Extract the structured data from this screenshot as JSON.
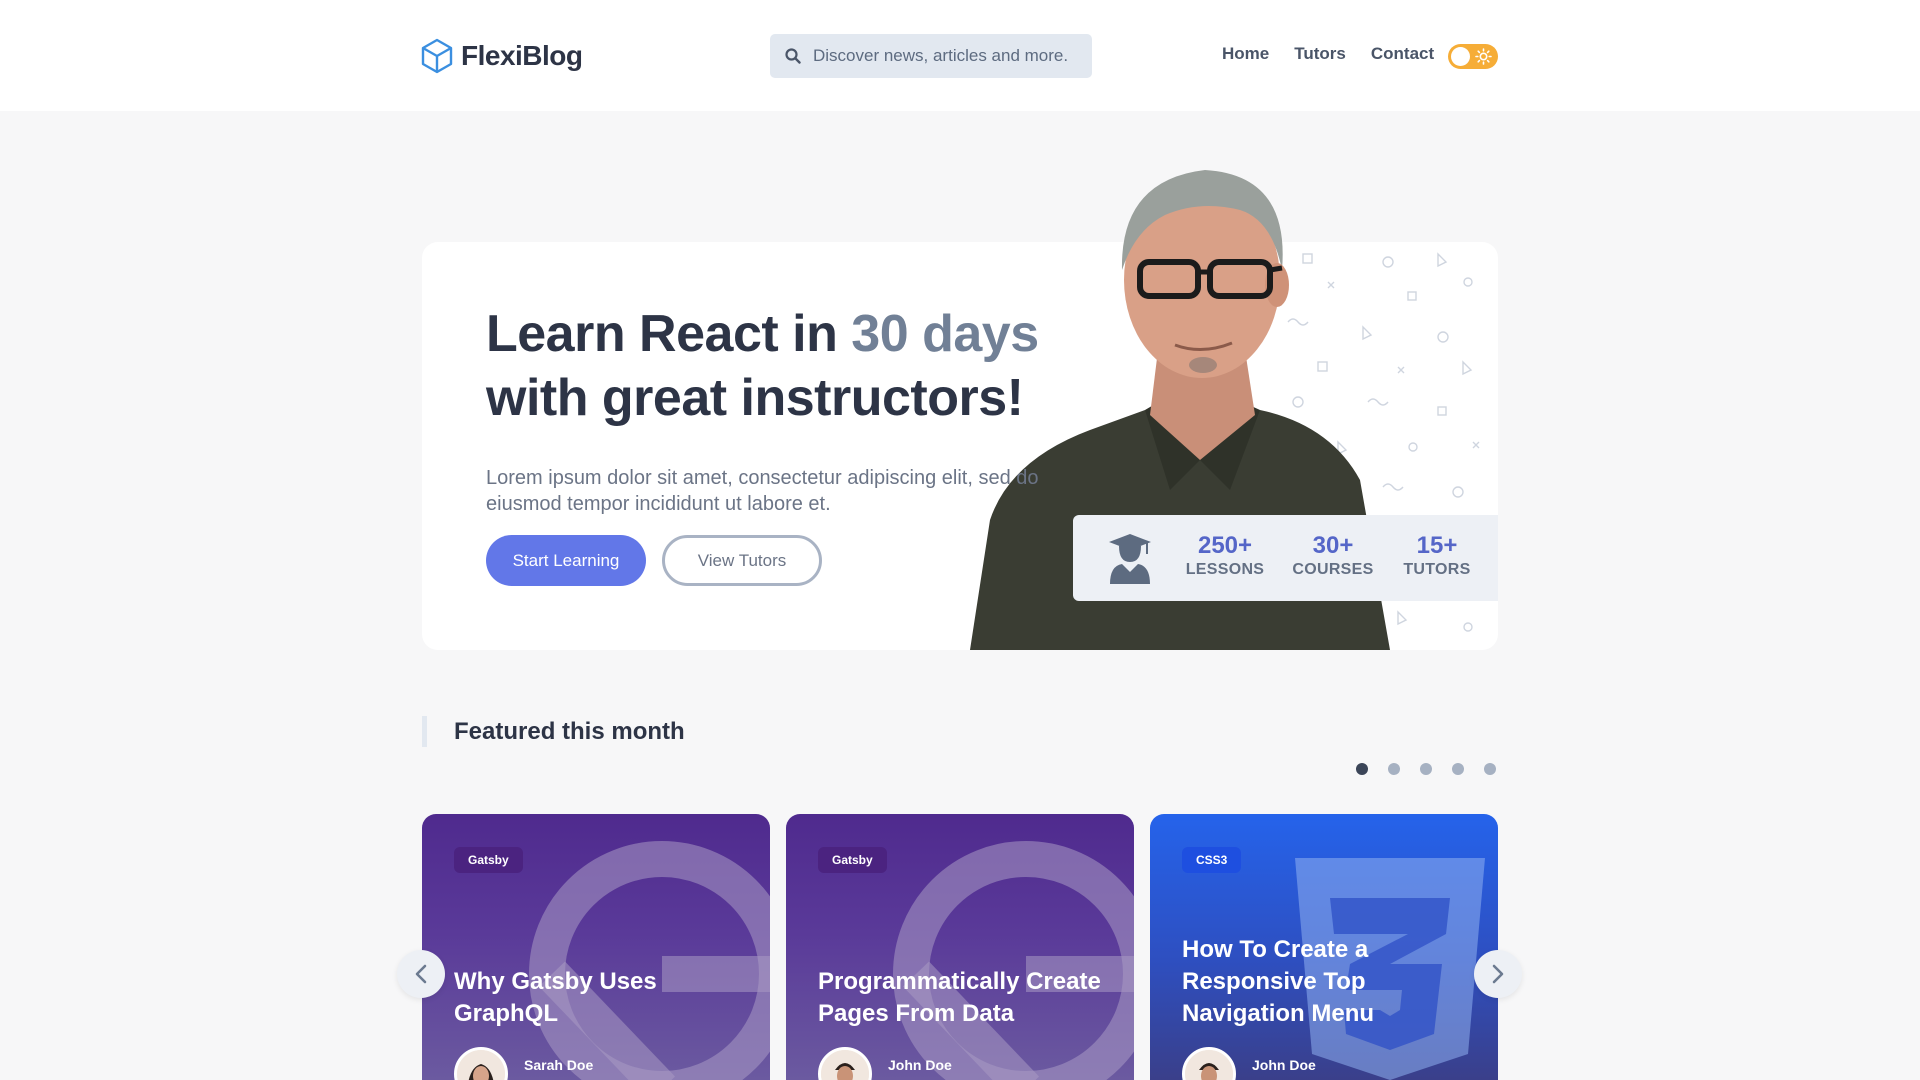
{
  "header": {
    "logo_text": "FlexiBlog",
    "search_placeholder": "Discover news, articles and more.",
    "nav": [
      "Home",
      "Tutors",
      "Contact"
    ]
  },
  "hero": {
    "title_part1": "Learn React in ",
    "title_accent": "30 days",
    "title_part2": "with great instructors!",
    "description": "Lorem ipsum dolor sit amet, consectetur adipiscing elit, sed do eiusmod tempor incididunt ut labore et.",
    "primary_button": "Start Learning",
    "secondary_button": "View Tutors",
    "stats": [
      {
        "value": "250+",
        "label": "LESSONS"
      },
      {
        "value": "30+",
        "label": "COURSES"
      },
      {
        "value": "15+",
        "label": "TUTORS"
      }
    ]
  },
  "featured": {
    "title": "Featured this month",
    "slides_count": 5,
    "active_slide": 1,
    "cards": [
      {
        "tag": "Gatsby",
        "title": "Why Gatsby Uses GraphQL",
        "author": "Sarah Doe"
      },
      {
        "tag": "Gatsby",
        "title": "Programmatically Create Pages From Data",
        "author": "John Doe"
      },
      {
        "tag": "CSS3",
        "title": "How To Create a Responsive Top Navigation Menu",
        "author": "John Doe"
      }
    ]
  },
  "colors": {
    "accent": "#6277e8",
    "text_dark": "#2d3446",
    "text_muted": "#718096",
    "toggle": "#f6ad37"
  }
}
